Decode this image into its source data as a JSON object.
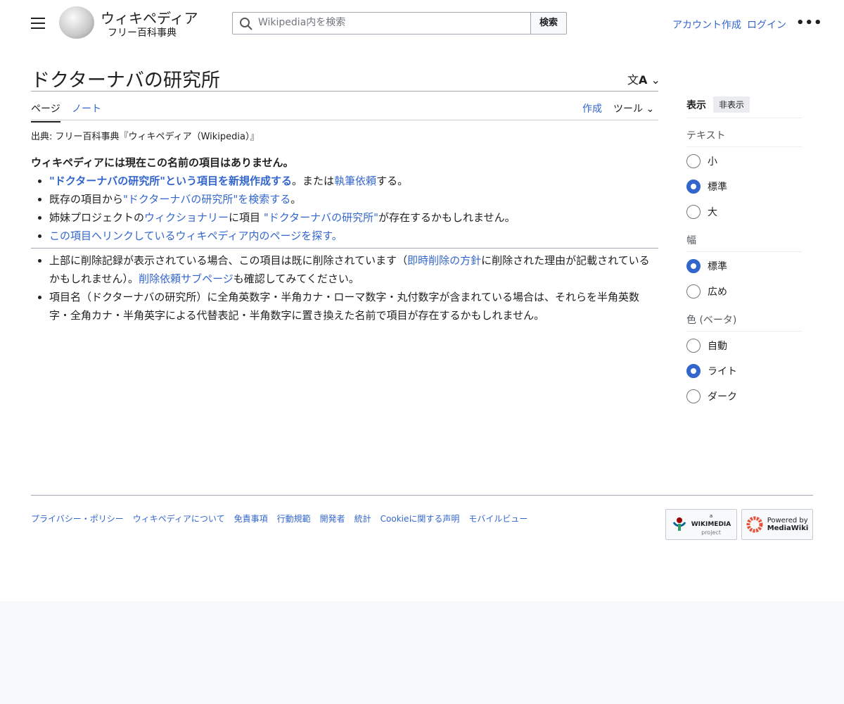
{
  "header": {
    "logo_title": "ウィキペディア",
    "logo_subtitle": "フリー百科事典",
    "search_placeholder": "Wikipedia内を検索",
    "search_button": "検索",
    "create_account": "アカウント作成",
    "login": "ログイン"
  },
  "page": {
    "title": "ドクターナバの研究所",
    "tabs": [
      "ページ",
      "ノート"
    ],
    "create": "作成",
    "tools": "ツール",
    "subtitle": "出典: フリー百科事典『ウィキペディア（Wikipedia）』"
  },
  "content": {
    "notice": "ウィキペディアには現在この名前の項目はありません。",
    "l1a": "\"ドクターナバの研究所\"という項目を新規作成する",
    "l1b": "。または",
    "l1c": "執筆依頼",
    "l1d": "する。",
    "l2a": "既存の項目から",
    "l2b": "\"ドクターナバの研究所\"を検索する",
    "l2c": "。",
    "l3a": "姉妹プロジェクトの",
    "l3b": "ウィクショナリー",
    "l3c": "に項目 ",
    "l3d": "\"ドクターナバの研究所\"",
    "l3e": "が存在するかもしれません。",
    "l4": "この項目へリンクしているウィキペディア内のページを探す。",
    "l5a": "上部に削除記録が表示されている場合、この項目は既に削除されています（",
    "l5b": "即時削除の方針",
    "l5c": "に削除された理由が記載されているかもしれません）。",
    "l5d": "削除依頼サブページ",
    "l5e": "も確認してみてください。",
    "l6": "項目名（ドクターナバの研究所）に全角英数字・半角カナ・ローマ数字・丸付数字が含まれている場合は、それらを半角英数字・全角カナ・半角英字による代替表記・半角数字に置き換えた名前で項目が存在するかもしれません。"
  },
  "sidebar": {
    "title": "表示",
    "hide": "非表示",
    "text_label": "テキスト",
    "text_options": [
      "小",
      "標準",
      "大"
    ],
    "width_label": "幅",
    "width_options": [
      "標準",
      "広め"
    ],
    "color_label": "色 (ベータ)",
    "color_options": [
      "自動",
      "ライト",
      "ダーク"
    ]
  },
  "footer": {
    "links": [
      "プライバシー・ポリシー",
      "ウィキペディアについて",
      "免責事項",
      "行動規範",
      "開発者",
      "統計",
      "Cookieに関する声明",
      "モバイルビュー"
    ],
    "wikimedia": [
      "a",
      "WIKIMEDIA",
      "project"
    ],
    "mediawiki": [
      "Powered by",
      "MediaWiki"
    ]
  }
}
